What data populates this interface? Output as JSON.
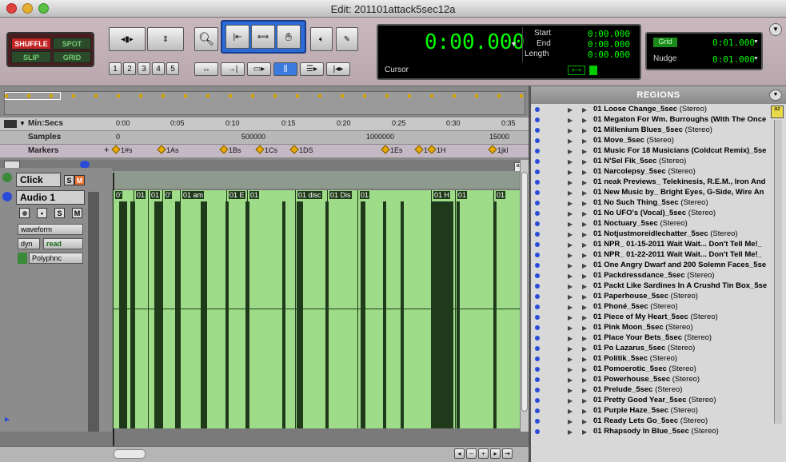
{
  "window": {
    "title": "Edit: 201101attack5sec12a"
  },
  "modes": {
    "shuffle": "SHUFFLE",
    "spot": "SPOT",
    "slip": "SLIP",
    "grid": "GRID"
  },
  "track_heights": [
    "1",
    "2",
    "3",
    "4",
    "5"
  ],
  "counter": {
    "main": "0:00.000",
    "cursor_label": "Cursor",
    "start_label": "Start",
    "end_label": "End",
    "length_label": "Length",
    "start": "0:00.000",
    "end": "0:00.000",
    "length": "0:00.000"
  },
  "grid": {
    "grid_label": "Grid",
    "grid_value": "0:01.000",
    "nudge_label": "Nudge",
    "nudge_value": "0:01.000"
  },
  "rulers": {
    "minsecs_label": "Min:Secs",
    "samples_label": "Samples",
    "markers_label": "Markers",
    "minsecs_ticks": [
      "0:00",
      "0:05",
      "0:10",
      "0:15",
      "0:20",
      "0:25",
      "0:30",
      "0:35"
    ],
    "sample_ticks": [
      "0",
      "500000",
      "1000000",
      "15000"
    ],
    "markers": [
      "1#s",
      "1As",
      "1Bs",
      "1Cs",
      "1DS",
      "1Es",
      "1",
      "1H",
      "1jkl"
    ]
  },
  "tracks": {
    "click": {
      "name": "Click",
      "solo": "S",
      "mute": "M"
    },
    "audio1": {
      "name": "Audio 1",
      "solo": "S",
      "mute": "M",
      "view": "waveform",
      "dyn": "dyn",
      "automation": "read",
      "insert": "Polyphnc"
    }
  },
  "clips": [
    "0'",
    "01",
    "01",
    "0'",
    "01 am",
    "01 E",
    "01",
    "01 disc",
    "01 Dis",
    "01",
    "01 H",
    "01",
    "01"
  ],
  "regions": {
    "header": "REGIONS",
    "items": [
      {
        "name": "01 Loose Change_5sec",
        "type": "(Stereo)"
      },
      {
        "name": "01 Megaton For Wm. Burroughs (With The Once",
        "type": ""
      },
      {
        "name": "01 Millenium Blues_5sec",
        "type": "(Stereo)"
      },
      {
        "name": "01 Move_5sec",
        "type": "(Stereo)"
      },
      {
        "name": "01 Music For 18 Musicians (Coldcut Remix)_5se",
        "type": ""
      },
      {
        "name": "01 N'Sel Fik_5sec",
        "type": "(Stereo)"
      },
      {
        "name": "01 Narcolepsy_5sec",
        "type": "(Stereo)"
      },
      {
        "name": "01 neak Previews_ Telekinesis, R.E.M., Iron And",
        "type": ""
      },
      {
        "name": "01 New Music by_ Bright Eyes, G-Side, Wire An",
        "type": ""
      },
      {
        "name": "01 No Such Thing_5sec",
        "type": "(Stereo)"
      },
      {
        "name": "01 No UFO's (Vocal)_5sec",
        "type": "(Stereo)"
      },
      {
        "name": "01 Noctuary_5sec",
        "type": "(Stereo)"
      },
      {
        "name": "01 Notjustmoreidlechatter_5sec",
        "type": "(Stereo)"
      },
      {
        "name": "01 NPR_ 01-15-2011 Wait Wait... Don't Tell Me!_",
        "type": ""
      },
      {
        "name": "01 NPR_ 01-22-2011 Wait Wait... Don't Tell Me!_",
        "type": ""
      },
      {
        "name": "01 One Angry Dwarf and 200 Solemn Faces_5se",
        "type": ""
      },
      {
        "name": "01 Packdressdance_5sec",
        "type": "(Stereo)"
      },
      {
        "name": "01 Packt Like Sardines In A Crushd Tin Box_5se",
        "type": ""
      },
      {
        "name": "01 Paperhouse_5sec",
        "type": "(Stereo)"
      },
      {
        "name": "01 Phoné_5sec",
        "type": "(Stereo)"
      },
      {
        "name": "01 Piece of My Heart_5sec",
        "type": "(Stereo)"
      },
      {
        "name": "01 Pink Moon_5sec",
        "type": "(Stereo)"
      },
      {
        "name": "01 Place Your Bets_5sec",
        "type": "(Stereo)"
      },
      {
        "name": "01 Po Lazarus_5sec",
        "type": "(Stereo)"
      },
      {
        "name": "01 Politik_5sec",
        "type": "(Stereo)"
      },
      {
        "name": "01 Pomoerotic_5sec",
        "type": "(Stereo)"
      },
      {
        "name": "01 Powerhouse_5sec",
        "type": "(Stereo)"
      },
      {
        "name": "01 Prelude_5sec",
        "type": "(Stereo)"
      },
      {
        "name": "01 Pretty Good Year_5sec",
        "type": "(Stereo)"
      },
      {
        "name": "01 Purple Haze_5sec",
        "type": "(Stereo)"
      },
      {
        "name": "01 Ready Lets Go_5sec",
        "type": "(Stereo)"
      },
      {
        "name": "01 Rhapsody In Blue_5sec",
        "type": "(Stereo)"
      }
    ]
  },
  "colors": {
    "lcd_green": "#00ff00",
    "waveform_bg": "#9fdc8a",
    "waveform_fg": "#1f3a1a",
    "marker": "#e8a800",
    "shuffle_red": "#ff3b3b"
  }
}
